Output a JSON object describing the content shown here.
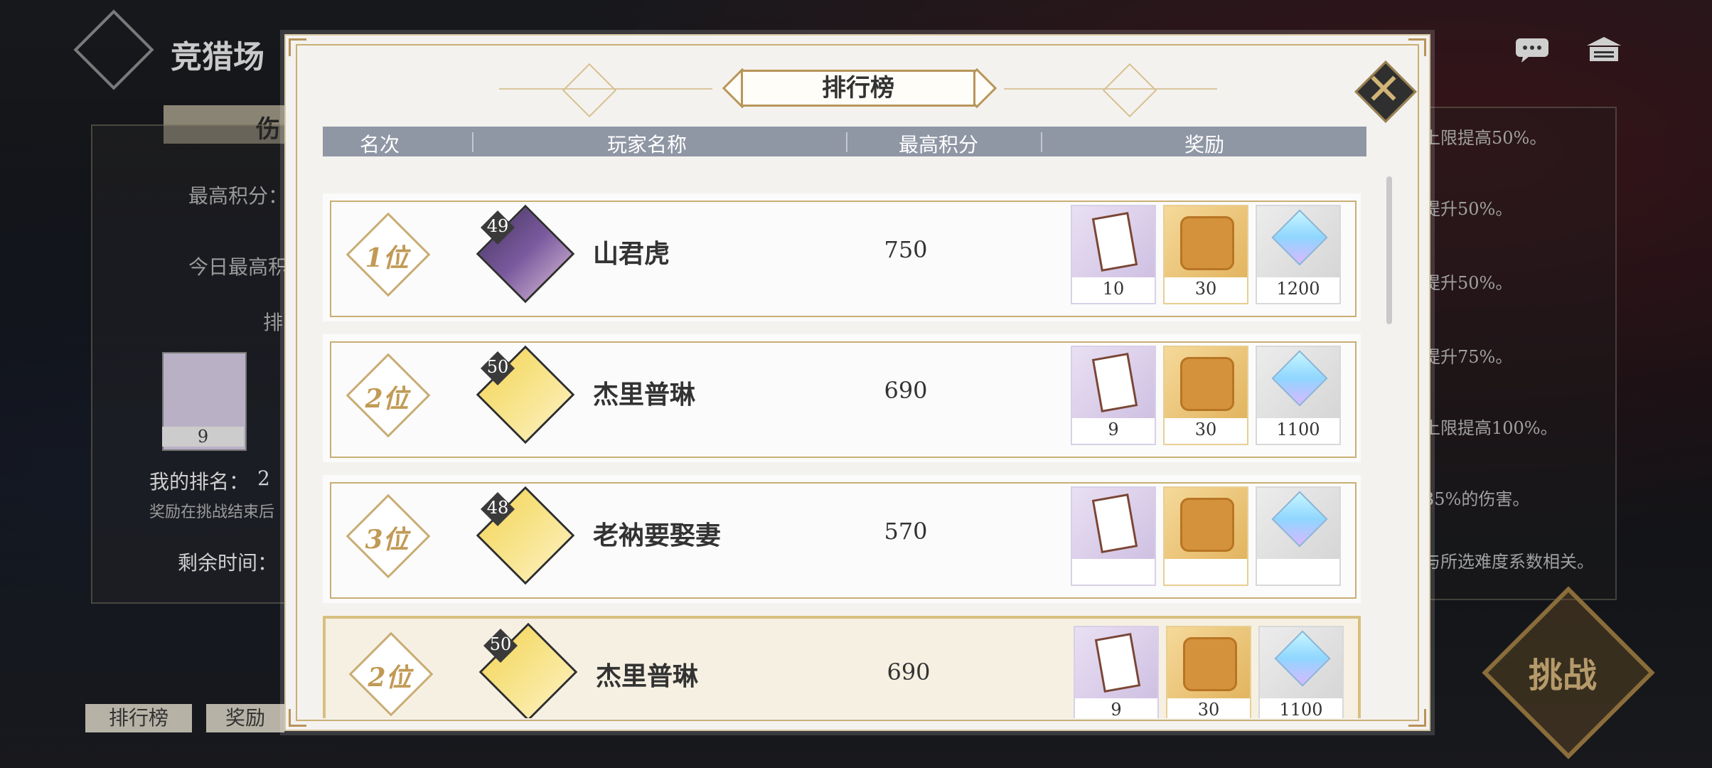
{
  "background": {
    "screen_title": "竞猎场",
    "tab_label": "伤",
    "stats": [
      "最高积分：",
      "今日最高积"
    ],
    "section_label": "排",
    "card_count": "9",
    "my_rank_label": "我的排名：",
    "my_rank_value": "2",
    "reward_note": "奖励在挑战结束后",
    "remaining_time": "剩余时间：",
    "right_notes": [
      "上限提高50%。",
      "提升50%。",
      "提升50%。",
      "提升75%。",
      "上限提高100%。",
      "35%的伤害。",
      "与所选难度系数相关。"
    ],
    "challenge_label": "挑战",
    "bottom_buttons": [
      "排行榜",
      "奖励"
    ]
  },
  "modal": {
    "title": "排行榜",
    "columns": [
      "名次",
      "玩家名称",
      "最高积分",
      "奖励"
    ]
  },
  "rows": [
    {
      "rank": "1位",
      "level": "49",
      "name": "山君虎",
      "score": "750",
      "rewards": [
        "10",
        "30",
        "1200"
      ]
    },
    {
      "rank": "2位",
      "level": "50",
      "name": "杰里普琳",
      "score": "690",
      "rewards": [
        "9",
        "30",
        "1100"
      ]
    },
    {
      "rank": "3位",
      "level": "48",
      "name": "老衲要娶妻",
      "score": "570",
      "rewards": [
        "",
        "",
        ""
      ]
    }
  ],
  "my_row": {
    "rank": "2位",
    "level": "50",
    "name": "杰里普琳",
    "score": "690",
    "rewards": [
      "9",
      "30",
      "1100"
    ]
  },
  "icons": [
    "close-icon",
    "chat-icon",
    "menu-icon",
    "reward-card-icon",
    "puzzle-piece-icon",
    "crystal-icon"
  ],
  "colors": {
    "gold": "#c9ae74",
    "header": "#8f96a4",
    "rank_text": "#c19a55"
  }
}
